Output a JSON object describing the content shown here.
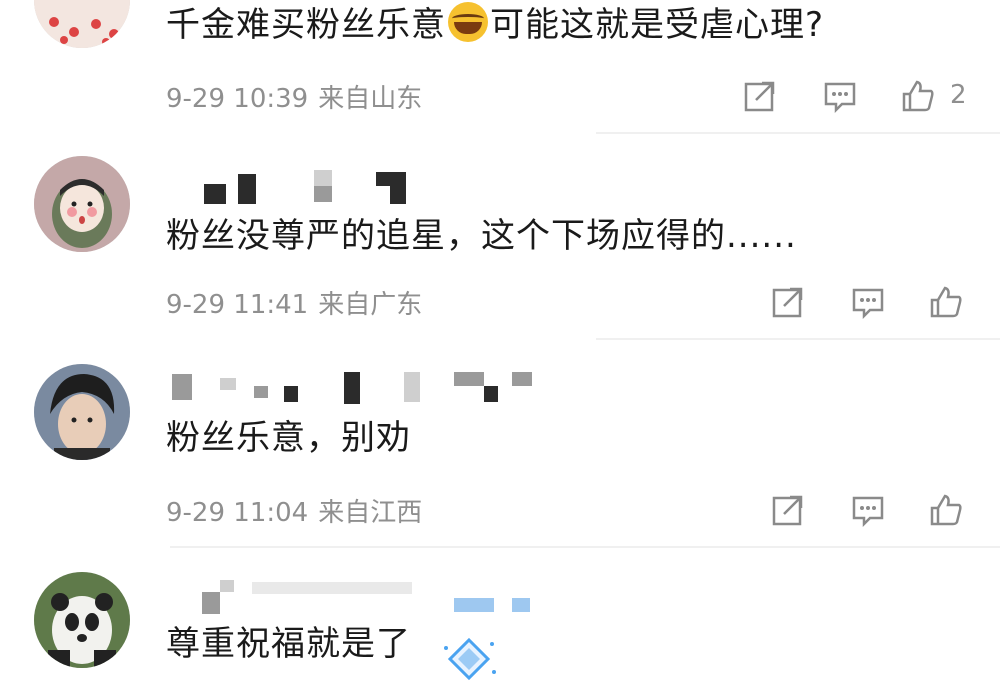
{
  "comments": [
    {
      "text_before": "千金难买粉丝乐意",
      "emoji": "laughing-tears-emoji",
      "text_after": "可能这就是受虐心理?",
      "date": "9-29 10:39",
      "location": "来自山东",
      "like_count": "2"
    },
    {
      "text": "粉丝没尊严的追星，这个下场应得的......",
      "date": "9-29 11:41",
      "location": "来自广东",
      "like_count": ""
    },
    {
      "text": "粉丝乐意，别劝",
      "date": "9-29 11:04",
      "location": "来自江西",
      "like_count": ""
    },
    {
      "text": "尊重祝福就是了",
      "badge": "diamond-badge"
    }
  ],
  "icons": {
    "share": "share-icon",
    "comment": "comment-icon",
    "like": "thumbs-up-icon"
  },
  "colors": {
    "meta_gray": "#8f8f8f",
    "text": "#1a1a1a",
    "badge_blue": "#4aa3f0"
  }
}
